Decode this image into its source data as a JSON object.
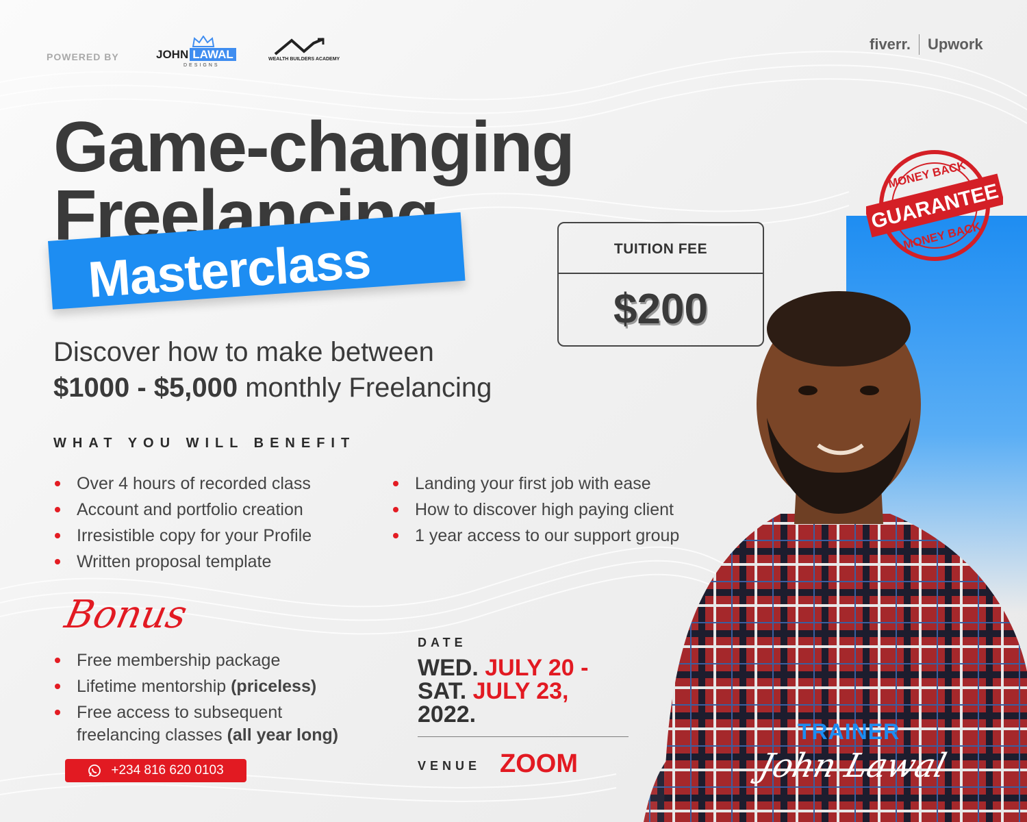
{
  "header": {
    "powered_by": "POWERED BY",
    "logo1": {
      "part1": "JOHN",
      "part2": "LAWAL",
      "sub": "DESIGNS"
    },
    "logo2": {
      "name": "WEALTH BUILDERS ACADEMY"
    },
    "platform1": "fiverr.",
    "platform2": "Upwork"
  },
  "title": {
    "line1": "Game-changing",
    "line2": "Freelancing",
    "banner": "Masterclass"
  },
  "subtitle": {
    "line1": "Discover how to make between",
    "amount": "$1000 - $5,000",
    "rest": " monthly Freelancing"
  },
  "fee": {
    "label": "TUITION FEE",
    "amount": "$200"
  },
  "stamp": {
    "top": "MONEY BACK",
    "middle": "GUARANTEE",
    "bottom": "MONEY BACK"
  },
  "benefits": {
    "heading": "WHAT YOU WILL BENEFIT",
    "left": [
      "Over 4 hours of recorded class",
      "Account and portfolio creation",
      "Irresistible copy for your Profile",
      "Written proposal template"
    ],
    "right": [
      "Landing your first job with ease",
      "How to discover high paying client",
      "1 year access to our support group"
    ]
  },
  "bonus": {
    "heading": "Bonus",
    "item1": "Free membership package",
    "item2_text": "Lifetime mentorship ",
    "item2_bold": "(priceless)",
    "item3_line1": "Free access to subsequent",
    "item3_line2": "freelancing classes ",
    "item3_bold": "(all year long)"
  },
  "contact": {
    "phone": "+234 816 620 0103",
    "icon": "whatsapp-icon"
  },
  "event": {
    "date_label": "DATE",
    "day1": "WED.",
    "date1": " JULY 20 -",
    "day2": "SAT.",
    "date2": " JULY 23,",
    "year": "2022.",
    "venue_label": "VENUE",
    "venue": "ZOOM"
  },
  "trainer": {
    "label": "TRAINER",
    "name": "John Lawal"
  },
  "colors": {
    "accent_blue": "#1d8df2",
    "accent_red": "#e21a22",
    "text_dark": "#3a3a3a"
  }
}
